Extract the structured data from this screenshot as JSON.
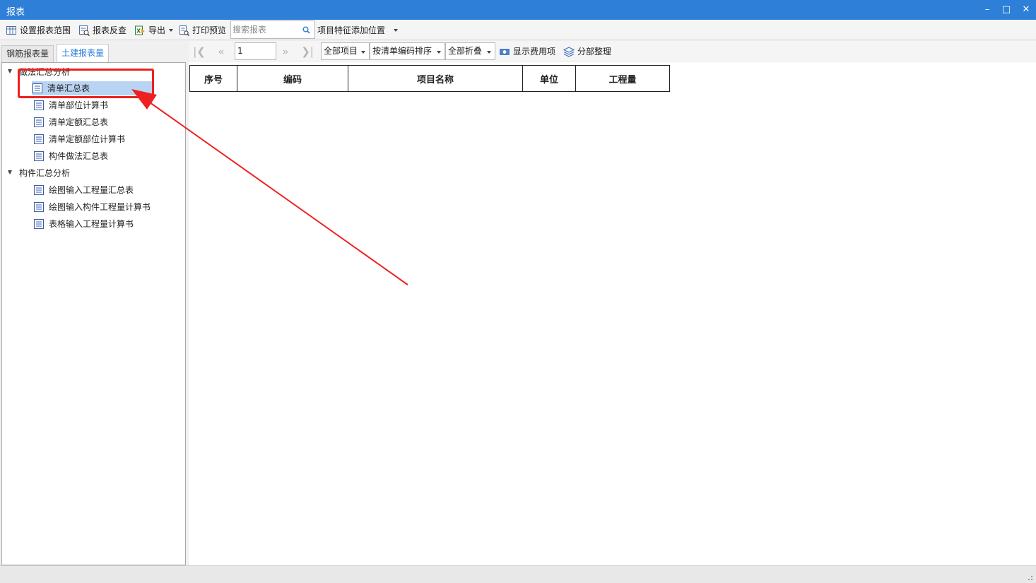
{
  "window": {
    "title": "报表"
  },
  "toolbar": {
    "set_range": "设置报表范围",
    "report_check": "报表反查",
    "export": "导出",
    "print_preview": "打印预览",
    "search_placeholder": "搜索报表",
    "feature_position": "项目特征添加位置"
  },
  "tabs": [
    {
      "label": "钢筋报表量"
    },
    {
      "label": "土建报表量"
    }
  ],
  "tree": {
    "groups": [
      {
        "label": "做法汇总分析",
        "items": [
          {
            "label": "清单汇总表"
          },
          {
            "label": "清单部位计算书"
          },
          {
            "label": "清单定额汇总表"
          },
          {
            "label": "清单定额部位计算书"
          },
          {
            "label": "构件做法汇总表"
          }
        ]
      },
      {
        "label": "构件汇总分析",
        "items": [
          {
            "label": "绘图输入工程量汇总表"
          },
          {
            "label": "绘图输入构件工程量计算书"
          },
          {
            "label": "表格输入工程量计算书"
          }
        ]
      }
    ],
    "selected": "清单汇总表"
  },
  "report_toolbar": {
    "page": "1",
    "filter": "全部项目",
    "sort": "按清单编码排序",
    "fold": "全部折叠",
    "show_fees": "显示费用项",
    "section_arrange": "分部整理"
  },
  "table": {
    "columns": [
      "序号",
      "编码",
      "项目名称",
      "单位",
      "工程量"
    ]
  },
  "colors": {
    "titlebar": "#2d7fd8",
    "annotation": "#ee2020",
    "selection": "#b9d3f3"
  }
}
